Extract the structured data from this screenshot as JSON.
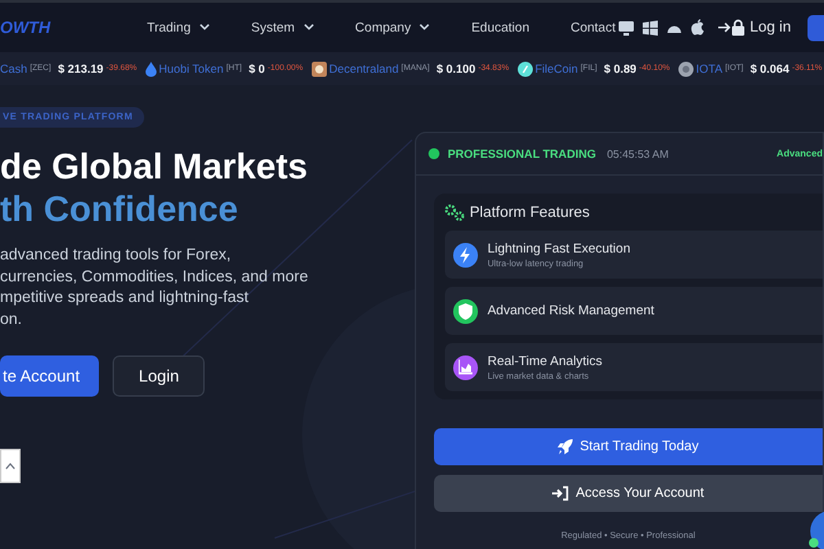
{
  "logo": {
    "text": "OWTH"
  },
  "nav": [
    {
      "label": "Trading",
      "dropdown": true
    },
    {
      "label": "System",
      "dropdown": true
    },
    {
      "label": "Company",
      "dropdown": true
    },
    {
      "label": "Education",
      "dropdown": false
    },
    {
      "label": "Contact",
      "dropdown": false
    }
  ],
  "login": "Log in",
  "ticker": [
    {
      "name": "Cash",
      "symbol": "[ZEC]",
      "price": "$ 213.19",
      "change": "-39.68%"
    },
    {
      "name": "Huobi Token",
      "symbol": "[HT]",
      "price": "$ 0",
      "change": "-100.00%"
    },
    {
      "name": "Decentraland",
      "symbol": "[MANA]",
      "price": "$ 0.100",
      "change": "-34.83%"
    },
    {
      "name": "FileCoin",
      "symbol": "[FIL]",
      "price": "$ 0.89",
      "change": "-40.10%"
    },
    {
      "name": "IOTA",
      "symbol": "[IOT]",
      "price": "$ 0.064",
      "change": "-36.11%"
    }
  ],
  "hero": {
    "badge": "VE TRADING PLATFORM",
    "headline_1": "de Global Markets",
    "headline_2": "th Confidence",
    "paragraph_lines": [
      "advanced trading tools for Forex,",
      "currencies, Commodities, Indices, and more",
      "mpetitive spreads and lightning-fast",
      "on."
    ],
    "buttons": [
      {
        "label": "te Account",
        "kind": "primary"
      },
      {
        "label": "Login",
        "kind": "secondary"
      }
    ]
  },
  "panel": {
    "status": "PROFESSIONAL TRADING",
    "time": "05:45:53 AM",
    "right_label": "Advanced",
    "features_title": "Platform Features",
    "features": [
      {
        "title": "Lightning Fast Execution",
        "subtitle": "Ultra-low latency trading",
        "color": "#3b82f6"
      },
      {
        "title": "Advanced Risk Management",
        "color": "#22c55e"
      },
      {
        "title": "Real-Time Analytics",
        "subtitle": "Live market data & charts",
        "color": "#a855f7"
      }
    ],
    "buttons": [
      {
        "label": "Start Trading Today",
        "kind": "primary"
      },
      {
        "label": "Access Your Account",
        "kind": "secondary"
      }
    ],
    "footer": "Regulated • Secure • Professional"
  }
}
